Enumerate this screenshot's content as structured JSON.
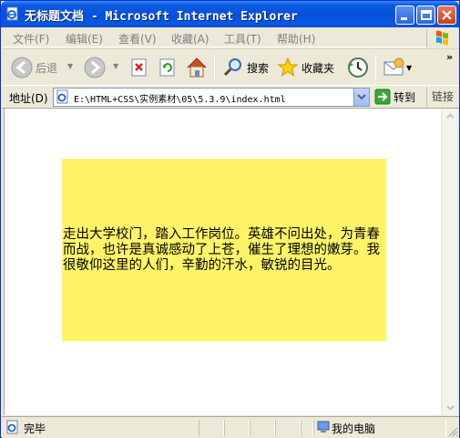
{
  "window": {
    "title": "无标题文档 - Microsoft Internet Explorer"
  },
  "menu": {
    "items": [
      "文件(F)",
      "编辑(E)",
      "查看(V)",
      "收藏(A)",
      "工具(T)",
      "帮助(H)"
    ]
  },
  "toolbar": {
    "back_label": "后退",
    "search_label": "搜索",
    "favorites_label": "收藏夹",
    "more_symbol": "»"
  },
  "address": {
    "label": "地址(D)",
    "url": "E:\\HTML+CSS\\实例素材\\05\\5.3.9\\index.html",
    "go_label": "转到",
    "links_label": "链接"
  },
  "content": {
    "paragraph": "走出大学校门，踏入工作岗位。英雄不问出处，为青春而战，也许是真诚感动了上苍，催生了理想的嫩芽。我很敬仰这里的人们，辛勤的汗水，敏锐的目光。",
    "box_color": "#fff467"
  },
  "status": {
    "text": "完毕",
    "zone": "我的电脑"
  }
}
